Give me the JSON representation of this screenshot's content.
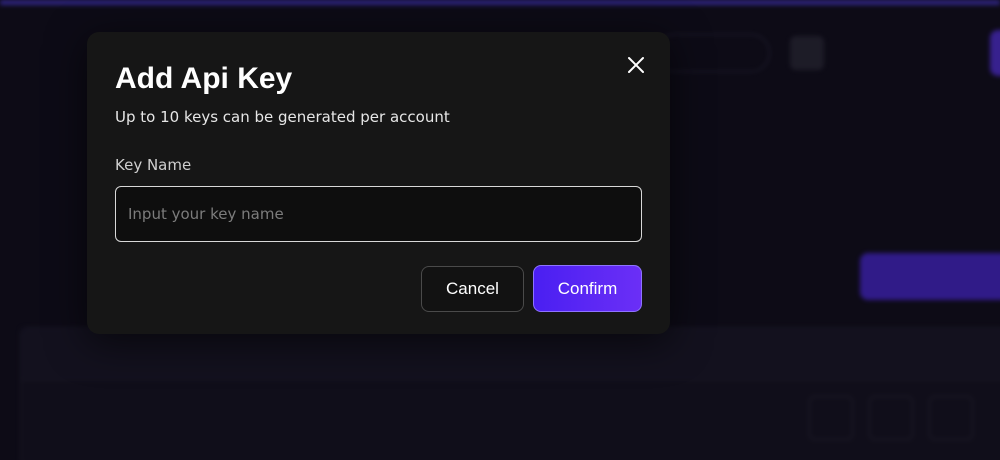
{
  "modal": {
    "title": "Add Api Key",
    "subtitle": "Up to 10 keys can be generated per account",
    "field_label": "Key Name",
    "input_value": "",
    "input_placeholder": "Input your key name",
    "cancel_label": "Cancel",
    "confirm_label": "Confirm",
    "close_icon": "close-icon"
  },
  "colors": {
    "accent": "#5b2ff4",
    "modal_bg": "#161616",
    "page_bg": "#0d0b16"
  }
}
